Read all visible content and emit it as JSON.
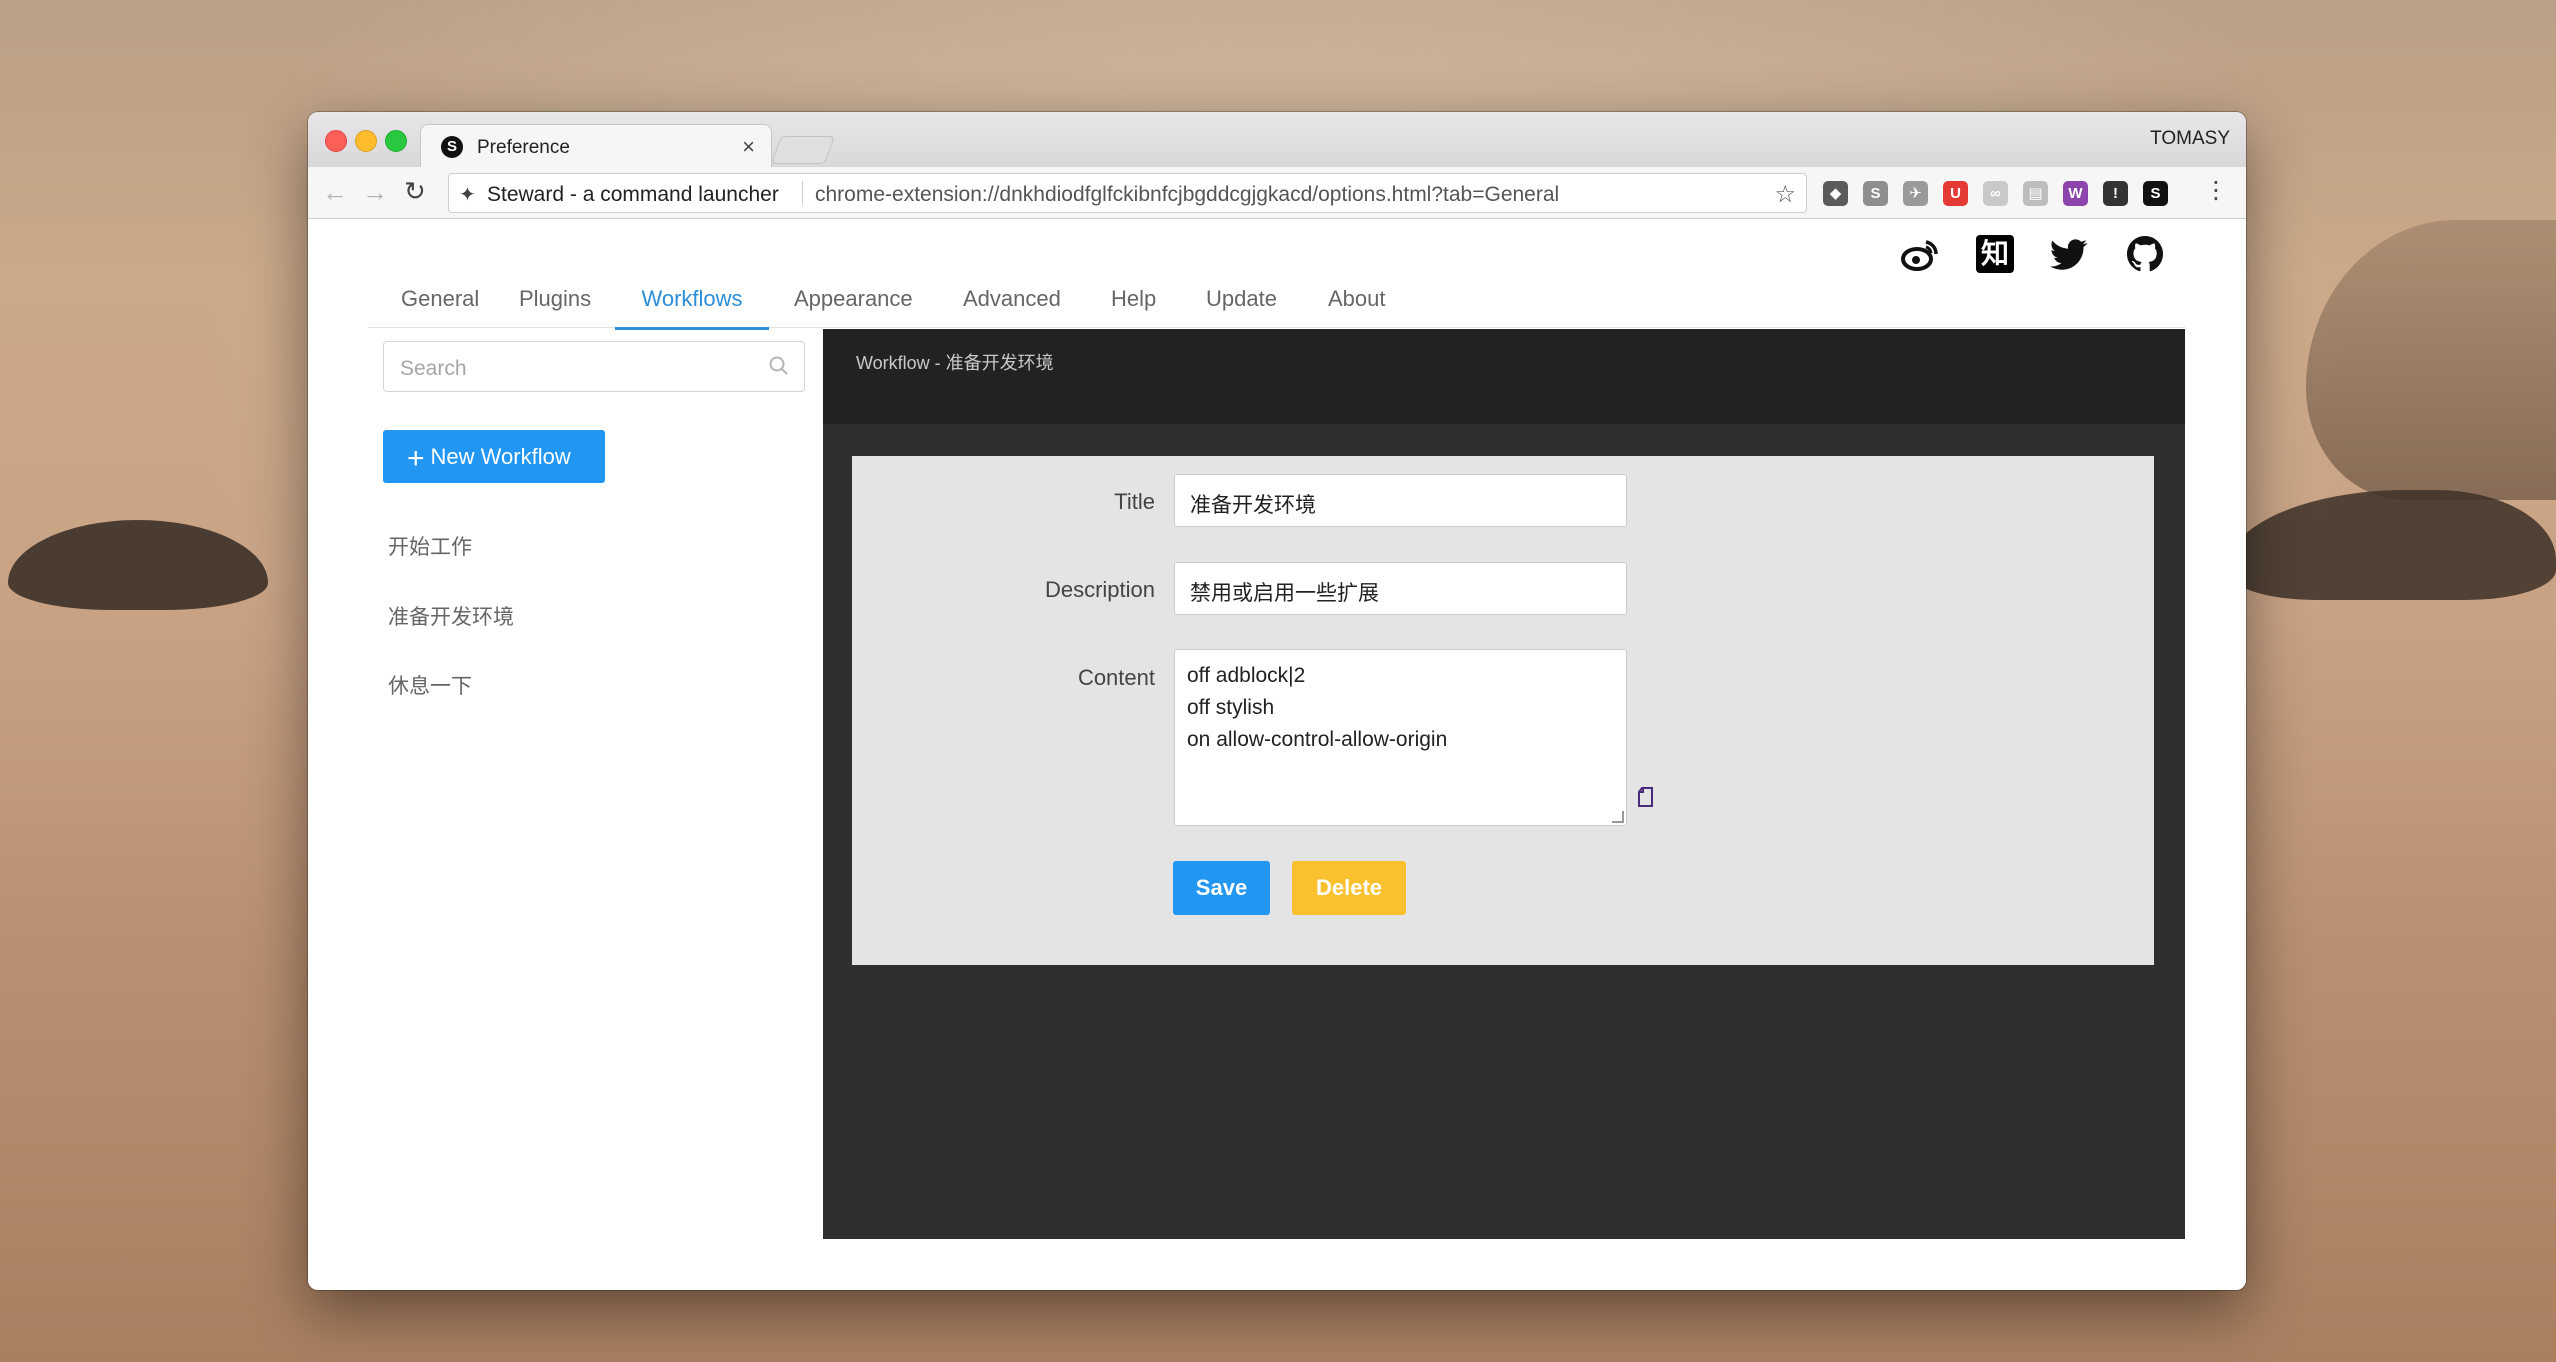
{
  "browser": {
    "tab_title": "Preference",
    "tab_favicon": "S",
    "profile_name": "TOMASY",
    "omnibox_extension_name": "Steward - a command launcher",
    "url": "chrome-extension://dnkhdiodfglfckibnfcjbgddcgjgkacd/options.html?tab=General",
    "extension_icons": [
      {
        "name": "pocket-icon",
        "color": "#5b5b5b",
        "glyph": "◆"
      },
      {
        "name": "sourcegraph-icon",
        "color": "#8e8e8e",
        "glyph": "S"
      },
      {
        "name": "compass-icon",
        "color": "#9a9a9a",
        "glyph": "✈"
      },
      {
        "name": "ublock-icon",
        "color": "#e53935",
        "glyph": "U"
      },
      {
        "name": "link-icon",
        "color": "#c9c9c9",
        "glyph": "∞"
      },
      {
        "name": "page-icon",
        "color": "#bdbdbd",
        "glyph": "▤"
      },
      {
        "name": "w-ext-icon",
        "color": "#8e44ad",
        "glyph": "W"
      },
      {
        "name": "info-icon",
        "color": "#333333",
        "glyph": "!"
      },
      {
        "name": "steward-icon",
        "color": "#111111",
        "glyph": "S"
      }
    ]
  },
  "social_icons": [
    "weibo-icon",
    "zhihu-icon",
    "twitter-icon",
    "github-icon"
  ],
  "zhihu_glyph": "知",
  "tabs": [
    {
      "label": "General"
    },
    {
      "label": "Plugins"
    },
    {
      "label": "Workflows"
    },
    {
      "label": "Appearance"
    },
    {
      "label": "Advanced"
    },
    {
      "label": "Help"
    },
    {
      "label": "Update"
    },
    {
      "label": "About"
    }
  ],
  "active_tab": "Workflows",
  "sidebar": {
    "search_placeholder": "Search",
    "new_button_label": "New Workflow",
    "workflows": [
      {
        "label": "开始工作"
      },
      {
        "label": "准备开发环境"
      },
      {
        "label": "休息一下"
      }
    ]
  },
  "panel": {
    "header_title": "Workflow - 准备开发环境",
    "form": {
      "title_label": "Title",
      "title_value": "准备开发环境",
      "description_label": "Description",
      "description_value": "禁用或启用一些扩展",
      "content_label": "Content",
      "content_lines": [
        "off adblock|2",
        "off stylish",
        "on allow-control-allow-origin"
      ],
      "save_label": "Save",
      "delete_label": "Delete"
    }
  },
  "colors": {
    "accent": "#2196f3",
    "warning": "#fbc02d",
    "panel_bg": "#2f2f2f",
    "form_bg": "#e4e4e4"
  }
}
